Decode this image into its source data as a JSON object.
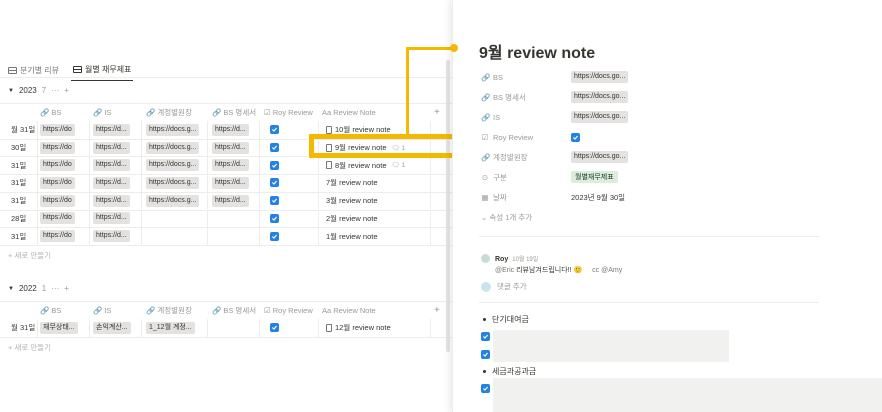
{
  "tabs": [
    {
      "label": "분기별 리뷰",
      "active": false
    },
    {
      "label": "월별 재무제표",
      "active": true
    }
  ],
  "groups": [
    {
      "name": "2023",
      "count": "7",
      "columns": [
        "BS",
        "IS",
        "계정별원장",
        "BS 명세서",
        "Roy Review",
        "Review Note"
      ],
      "rows": [
        {
          "date": "월 31일",
          "bs": "https://do",
          "is": "https://d...",
          "ledger": "https://docs.g...",
          "bsdetail": "https://d...",
          "review": true,
          "note": "10월 review note",
          "comment": ""
        },
        {
          "date": "30일",
          "bs": "https://do",
          "is": "https://d...",
          "ledger": "https://docs.g...",
          "bsdetail": "https://d...",
          "review": true,
          "note": "9월 review note",
          "comment": "1"
        },
        {
          "date": "31일",
          "bs": "https://do",
          "is": "https://d...",
          "ledger": "https://docs.g...",
          "bsdetail": "https://d...",
          "review": true,
          "note": "8월 review note",
          "comment": "1"
        },
        {
          "date": "31일",
          "bs": "https://do",
          "is": "https://d...",
          "ledger": "https://docs.g...",
          "bsdetail": "https://d...",
          "review": true,
          "note": "7월 review note",
          "comment": ""
        },
        {
          "date": "31일",
          "bs": "https://do",
          "is": "https://d...",
          "ledger": "https://docs.g...",
          "bsdetail": "https://d...",
          "review": true,
          "note": "3월 review note",
          "comment": ""
        },
        {
          "date": "28일",
          "bs": "https://do",
          "is": "https://d...",
          "ledger": "",
          "bsdetail": "",
          "review": true,
          "note": "2월 review note",
          "comment": ""
        },
        {
          "date": "31일",
          "bs": "https://do",
          "is": "https://d...",
          "ledger": "",
          "bsdetail": "",
          "review": true,
          "note": "1월 review note",
          "comment": ""
        }
      ],
      "new_label": "+ 새로 만들기"
    },
    {
      "name": "2022",
      "count": "1",
      "columns": [
        "BS",
        "IS",
        "계정별원장",
        "BS 명세서",
        "Roy Review",
        "Review Note"
      ],
      "rows": [
        {
          "date": "월 31일",
          "bs": "재무상태...",
          "is": "손익계산...",
          "ledger": "1_12월 계정...",
          "bsdetail": "",
          "review": true,
          "note": "12월 review note",
          "comment": ""
        }
      ],
      "new_label": "+ 새로 만들기"
    }
  ],
  "panel": {
    "title": "9월 review note",
    "props": [
      {
        "icon": "link-icon",
        "name": "BS",
        "value": "https://docs.go...",
        "kind": "pill"
      },
      {
        "icon": "link-icon",
        "name": "BS 명세서",
        "value": "https://docs.go...",
        "kind": "pill"
      },
      {
        "icon": "link-icon",
        "name": "IS",
        "value": "https://docs.go...",
        "kind": "pill"
      },
      {
        "icon": "checkbox-icon",
        "name": "Roy Review",
        "value": "",
        "kind": "check"
      },
      {
        "icon": "link-icon",
        "name": "계정별원장",
        "value": "https://docs.go...",
        "kind": "pill"
      },
      {
        "icon": "select-icon",
        "name": "구분",
        "value": "월별재무제표",
        "kind": "tag"
      },
      {
        "icon": "calendar-icon",
        "name": "날짜",
        "value": "2023년 9월 30일",
        "kind": "text"
      }
    ],
    "more_props": "속성 1개 추가",
    "comment": {
      "author": "Roy",
      "date": "10월 19일",
      "mention": "@Eric",
      "body": " 리뷰남겨드립니다!! 🙂",
      "cc": "cc @Amy"
    },
    "add_comment": "댓글 추가",
    "bullets": [
      "단기대여금",
      "세금과공과금"
    ],
    "colors": {
      "accent": "#f5b800",
      "check": "#2383e2",
      "tag_bg": "#dbeddb"
    }
  }
}
